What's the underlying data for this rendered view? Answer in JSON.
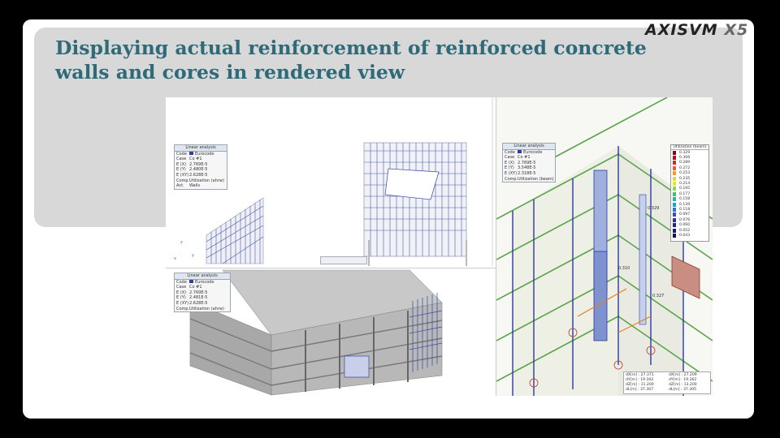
{
  "brand": {
    "name": "AXISVM",
    "version": "X5"
  },
  "title": {
    "line1": "Displaying actual reinforcement of reinforced concrete",
    "line2": "walls and cores in rendered view"
  },
  "panel_walls": {
    "header": "Linear analysis",
    "rows": [
      {
        "k": "Code",
        "v": "Eurocode"
      },
      {
        "k": "Case",
        "v": "Co #1"
      },
      {
        "k": "E (X)",
        "v": "2.769E-5"
      },
      {
        "k": "E (Y)",
        "v": "2.480E-5"
      },
      {
        "k": "E (XY)",
        "v": "2.628E-5"
      },
      {
        "k": "Comp.",
        "v": "Utilization (ahrw)"
      },
      {
        "k": "Act.",
        "v": "Walls"
      }
    ]
  },
  "panel_building": {
    "header": "Linear analysis",
    "rows": [
      {
        "k": "Code",
        "v": "Eurocode"
      },
      {
        "k": "Case",
        "v": "Co #1"
      },
      {
        "k": "E (X)",
        "v": "2.769E-5"
      },
      {
        "k": "E (Y)",
        "v": "2.481E-5"
      },
      {
        "k": "E (XY)",
        "v": "2.628E-5"
      },
      {
        "k": "Comp.",
        "v": "Utilization (ahrw)"
      }
    ]
  },
  "panel_core": {
    "header": "Linear analysis",
    "rows": [
      {
        "k": "Code",
        "v": "Eurocode"
      },
      {
        "k": "Case",
        "v": "Co #1"
      },
      {
        "k": "E (X)",
        "v": "2.769E-5"
      },
      {
        "k": "E (Y)",
        "v": "3.548E-5"
      },
      {
        "k": "E (XY)",
        "v": "2.318E-5"
      },
      {
        "k": "Comp.",
        "v": "Utilization (beam)"
      }
    ]
  },
  "legend": {
    "title": "Utilization (beam)",
    "entries": [
      {
        "v": "0.329",
        "c": "#7a0a16"
      },
      {
        "v": "0.306",
        "c": "#a8121c"
      },
      {
        "v": "0.289",
        "c": "#d42a22"
      },
      {
        "v": "0.272",
        "c": "#ef5a2a"
      },
      {
        "v": "0.253",
        "c": "#f79a34"
      },
      {
        "v": "0.235",
        "c": "#f6d23a"
      },
      {
        "v": "0.214",
        "c": "#d9ea3a"
      },
      {
        "v": "0.195",
        "c": "#8bd84a"
      },
      {
        "v": "0.177",
        "c": "#3fc46a"
      },
      {
        "v": "0.158",
        "c": "#23b9a6"
      },
      {
        "v": "0.139",
        "c": "#1e9fd9"
      },
      {
        "v": "0.118",
        "c": "#2f73d6"
      },
      {
        "v": "0.097",
        "c": "#3650c4"
      },
      {
        "v": "0.076",
        "c": "#2a36a0"
      },
      {
        "v": "0.060",
        "c": "#1e2a80"
      },
      {
        "v": "0.052",
        "c": "#182068"
      },
      {
        "v": "0.043",
        "c": "#121852"
      }
    ]
  },
  "coords": {
    "col1": [
      "dX[m] : 27.371",
      "dY[m] : 19.302",
      "dZ[m] : 11.200",
      "dL[m] : 37.307"
    ],
    "col2": [
      "dX[m] : 27.209",
      "dY[m] : 19.362",
      "dZ[m] : 13.200",
      "dL[m] : 37.305"
    ]
  },
  "value_labels": [
    "0.329",
    "0.327",
    "0.310"
  ],
  "axes": {
    "x": "x",
    "y": "y",
    "z": "z"
  }
}
